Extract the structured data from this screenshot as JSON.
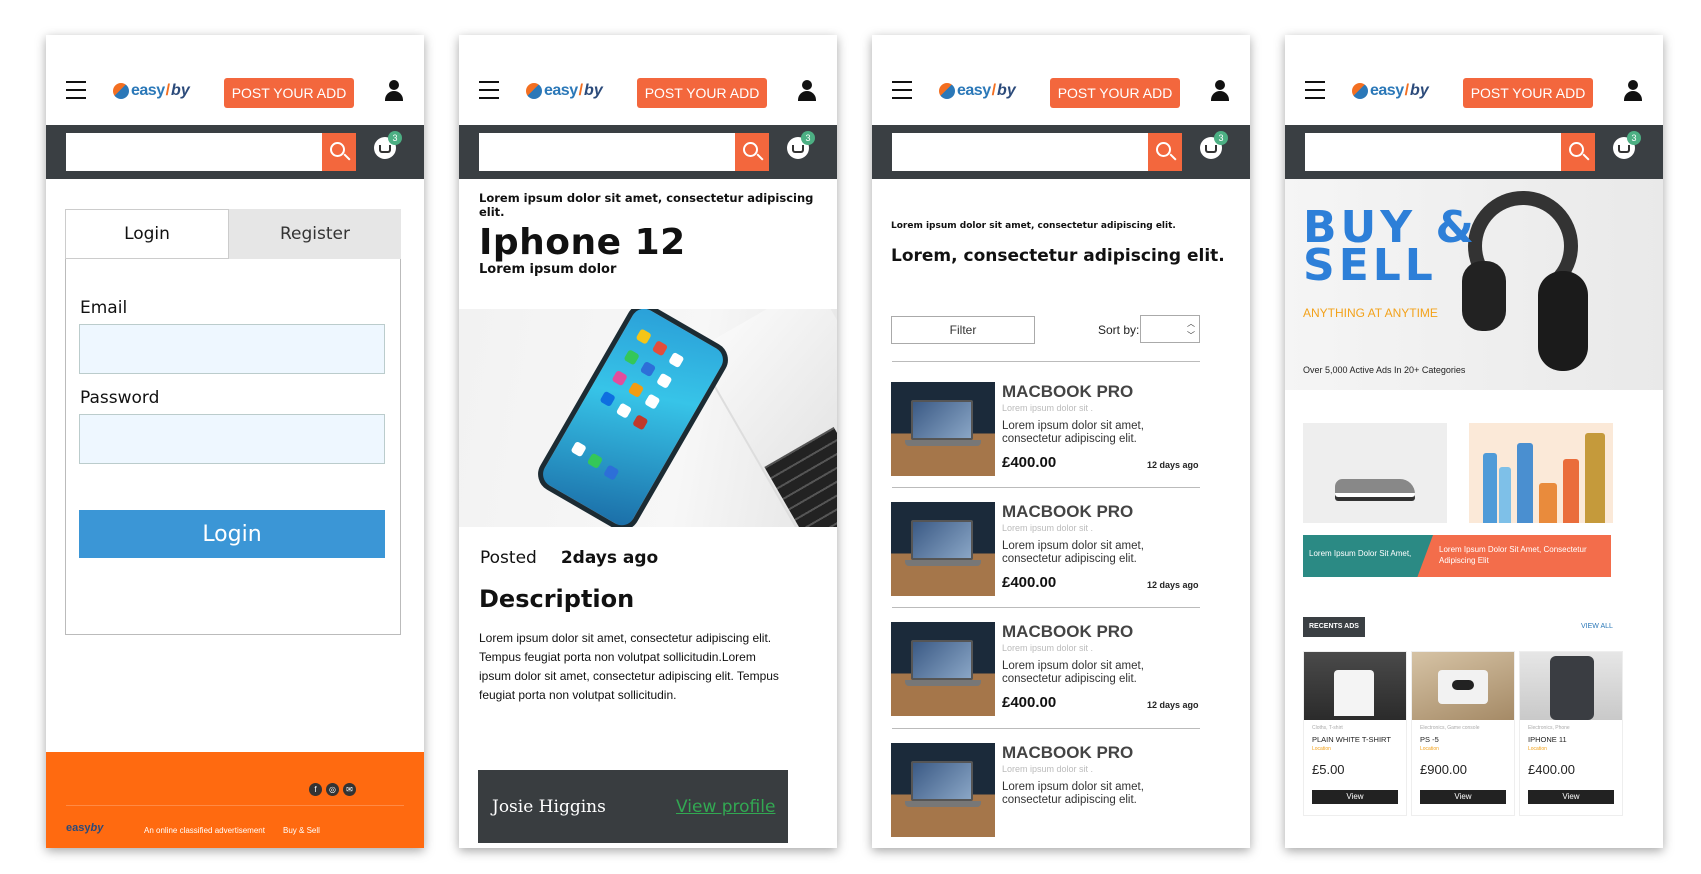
{
  "header": {
    "logo_easy": "easy",
    "logo_slash": "/",
    "logo_by": "by",
    "post_button": "POST YOUR ADD",
    "cart_count": "3",
    "icons": [
      "hamburger-icon",
      "user-icon",
      "search-icon",
      "basket-icon"
    ]
  },
  "login": {
    "tab_login": "Login",
    "tab_register": "Register",
    "email_label": "Email",
    "password_label": "Password",
    "submit": "Login",
    "footer_logo_easy": "easy",
    "footer_logo_by": "by",
    "footer_tagline": "An online classified advertisement",
    "footer_link": "Buy & Sell",
    "footer_icons": [
      "f",
      "◎",
      "✉"
    ]
  },
  "detail": {
    "kicker": "Lorem ipsum dolor sit amet, consectetur adipiscing elit.",
    "title": "Iphone 12",
    "subtitle": "Lorem ipsum dolor",
    "posted_label": "Posted",
    "posted_value": "2days ago",
    "description_heading": "Description",
    "description": "Lorem ipsum dolor sit amet, consectetur adipiscing elit. Tempus feugiat porta non volutpat sollicitudin.Lorem ipsum dolor sit amet, consectetur adipiscing elit. Tempus feugiat porta non volutpat sollicitudin.",
    "seller_name": "Josie Higgins",
    "view_profile": "View profile"
  },
  "listing": {
    "kicker": "Lorem ipsum dolor sit amet, consectetur adipiscing elit.",
    "heading": "Lorem, consectetur adipiscing elit.",
    "filter": "Filter",
    "sort_label": "Sort by:",
    "items": [
      {
        "name": "MACBOOK PRO",
        "sub": "Lorem ipsum dolor sit .",
        "desc": "Lorem ipsum dolor sit amet, consectetur adipiscing elit.",
        "price": "£400.00",
        "date": "12 days ago"
      },
      {
        "name": "MACBOOK PRO",
        "sub": "Lorem ipsum dolor sit .",
        "desc": "Lorem ipsum dolor sit amet, consectetur adipiscing elit.",
        "price": "£400.00",
        "date": "12 days ago"
      },
      {
        "name": "MACBOOK PRO",
        "sub": "Lorem ipsum dolor sit .",
        "desc": "Lorem ipsum dolor sit amet, consectetur adipiscing elit.",
        "price": "£400.00",
        "date": "12 days ago"
      },
      {
        "name": "MACBOOK PRO",
        "sub": "Lorem ipsum dolor sit .",
        "desc": "Lorem ipsum dolor sit amet, consectetur adipiscing elit.",
        "price": "",
        "date": ""
      }
    ]
  },
  "home": {
    "hero_line1": "BUY &",
    "hero_line2": "SELL",
    "hero_tagline": "ANYTHING AT ANYTIME",
    "hero_stats": "Over 5,000  Active Ads In 20+ Categories",
    "promo_left": "Lorem Ipsum Dolor Sit Amet,",
    "promo_right": "Lorem Ipsum Dolor Sit Amet, Consectetur Adipiscing Elit",
    "recent_label": "RECENTS ADS",
    "view_all": "VIEW ALL",
    "cards": [
      {
        "category": "Cloths, T-shirt",
        "name": "PLAIN WHITE T-SHIRT",
        "location": "Location",
        "price": "£5.00",
        "button": "View"
      },
      {
        "category": "Electronics, Game console",
        "name": "PS -5",
        "location": "Location",
        "price": "£900.00",
        "button": "View"
      },
      {
        "category": "Electronics, Phone",
        "name": "IPHONE 11",
        "location": "Location",
        "price": "£400.00",
        "button": "View"
      }
    ]
  },
  "colors": {
    "accent_orange": "#f3673d",
    "dark_bar": "#3a3f43",
    "login_blue": "#3b96d6",
    "footer_orange": "#ff6a10",
    "brand_blue": "#2d7fd8",
    "profile_green": "#32a852"
  }
}
